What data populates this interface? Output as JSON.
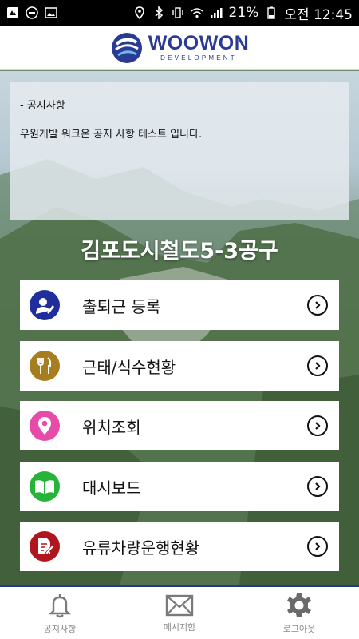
{
  "status_bar": {
    "battery": "21%",
    "time": "오전 12:45",
    "left_icons": [
      "notification-icon",
      "minus-circle-icon",
      "image-icon"
    ],
    "right_icons": [
      "location-icon",
      "bluetooth-icon",
      "vibrate-icon",
      "wifi-icon",
      "signal-icon",
      "battery-icon"
    ]
  },
  "header": {
    "logo_main": "WOOWON",
    "logo_sub": "DEVELOPMENT",
    "brand_color": "#2a3b93"
  },
  "notice": {
    "title": "- 공지사항",
    "body": "우원개발 워크온 공지 사항 테스트 입니다."
  },
  "site_title": "김포도시철도5-3공구",
  "menu": [
    {
      "label": "출퇴근 등록",
      "icon": "user-edit-icon",
      "color": "#1f2e9b"
    },
    {
      "label": "근태/식수현황",
      "icon": "fork-knife-icon",
      "color": "#a77d21"
    },
    {
      "label": "위치조회",
      "icon": "location-pin-icon",
      "color": "#e64ba8"
    },
    {
      "label": "대시보드",
      "icon": "book-icon",
      "color": "#27b23a"
    },
    {
      "label": "유류차량운행현황",
      "icon": "document-edit-icon",
      "color": "#b0161d"
    }
  ],
  "tabs": [
    {
      "label": "공지사항",
      "icon": "bell-icon"
    },
    {
      "label": "메시지함",
      "icon": "mail-icon"
    },
    {
      "label": "로그아웃",
      "icon": "gear-icon"
    }
  ]
}
